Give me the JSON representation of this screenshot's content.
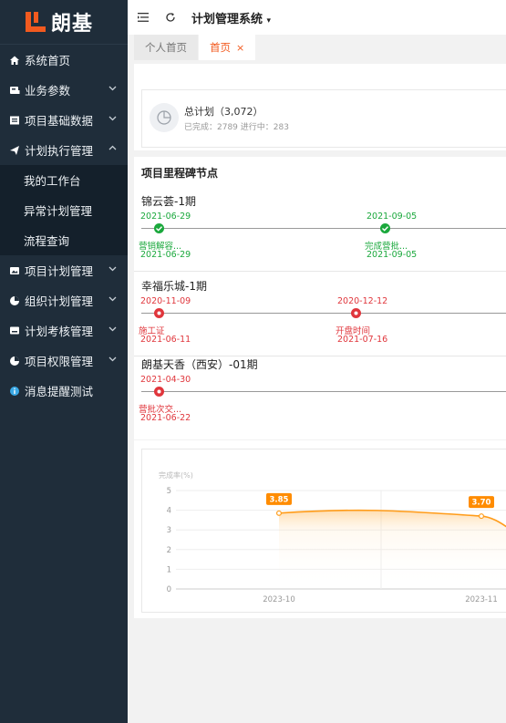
{
  "sidebar": {
    "logo_text": "朗基",
    "items": [
      {
        "label": "系统首页",
        "icon": "home-icon",
        "arrow": ""
      },
      {
        "label": "业务参数",
        "icon": "dashboard-icon",
        "arrow": "⌄"
      },
      {
        "label": "项目基础数据",
        "icon": "list-icon",
        "arrow": "⌄"
      },
      {
        "label": "计划执行管理",
        "icon": "send-icon",
        "arrow": "⌃"
      }
    ],
    "sub_items": [
      {
        "label": "我的工作台"
      },
      {
        "label": "异常计划管理"
      },
      {
        "label": "流程查询"
      }
    ],
    "items_after": [
      {
        "label": "项目计划管理",
        "icon": "image-icon",
        "arrow": "⌄"
      },
      {
        "label": "组织计划管理",
        "icon": "pie-icon",
        "arrow": "⌄"
      },
      {
        "label": "计划考核管理",
        "icon": "monitor-icon",
        "arrow": "⌄"
      },
      {
        "label": "项目权限管理",
        "icon": "pie-icon",
        "arrow": "⌄"
      },
      {
        "label": "消息提醒测试",
        "icon": "info-icon",
        "arrow": ""
      }
    ]
  },
  "topbar": {
    "title": "计划管理系统"
  },
  "tabs": [
    {
      "label": "个人首页"
    },
    {
      "label": "首页",
      "close": "×"
    }
  ],
  "summary": {
    "title": "总计划（3,072）",
    "sub": "已完成：2789   进行中：283"
  },
  "milestones": {
    "heading": "项目里程碑节点",
    "projects": [
      {
        "name": "锦云荟-1期",
        "nodes": [
          {
            "top_date": "2021-06-29",
            "label": "营销解容...",
            "bottom_date": "2021-06-29",
            "status": "done"
          },
          {
            "top_date": "2021-09-05",
            "label": "完成营批...",
            "bottom_date": "2021-09-05",
            "status": "done"
          }
        ]
      },
      {
        "name": "幸福乐城-1期",
        "nodes": [
          {
            "top_date": "2020-11-09",
            "label": "施工证",
            "bottom_date": "2021-06-11",
            "status": "late"
          },
          {
            "top_date": "2020-12-12",
            "label": "开盘时间",
            "bottom_date": "2021-07-16",
            "status": "late"
          }
        ]
      },
      {
        "name": "朗基天香（西安）-01期",
        "nodes": [
          {
            "top_date": "2021-04-30",
            "label": "营批次交...",
            "bottom_date": "2021-06-22",
            "status": "late"
          }
        ]
      }
    ]
  },
  "chart_data": {
    "type": "line",
    "ylabel": "完成率(%)",
    "ylim": [
      0,
      5
    ],
    "yticks": [
      "0",
      "1",
      "2",
      "3",
      "4",
      "5"
    ],
    "categories": [
      "2023-10",
      "2023-11"
    ],
    "x": [
      "2023-10",
      "2023-11"
    ],
    "values": [
      3.85,
      3.7
    ],
    "value_labels": [
      "3.85",
      "3.70"
    ],
    "colors": {
      "line": "#ff9c1a",
      "label_bg": "#ff8c00"
    }
  }
}
